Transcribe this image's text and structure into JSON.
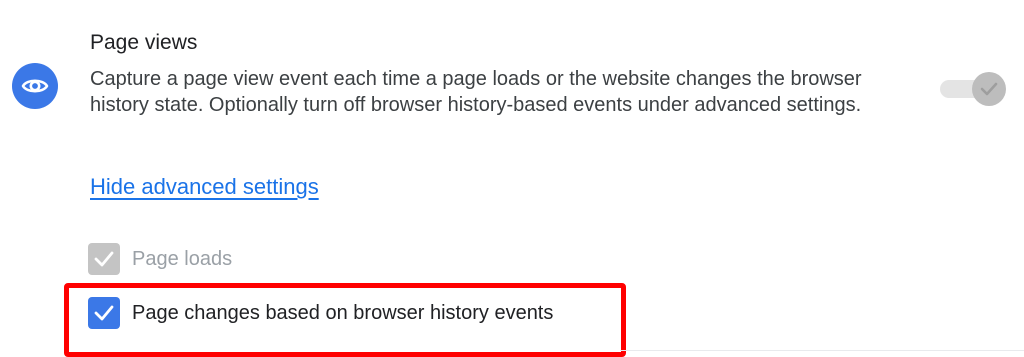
{
  "section": {
    "title": "Page views",
    "description": "Capture a page view event each time a page loads or the website changes the browser history state. Optionally turn off browser history-based events under advanced settings.",
    "icon": "eye-icon",
    "toggle_enabled": true
  },
  "advanced": {
    "link_label": "Hide advanced settings",
    "options": [
      {
        "label": "Page loads",
        "checked": true,
        "disabled": true
      },
      {
        "label": "Page changes based on browser history events",
        "checked": true,
        "disabled": false
      }
    ]
  },
  "colors": {
    "accent": "#3b78e7",
    "link": "#1a73e8",
    "highlight": "#ff0000",
    "disabled": "#c4c4c4"
  }
}
